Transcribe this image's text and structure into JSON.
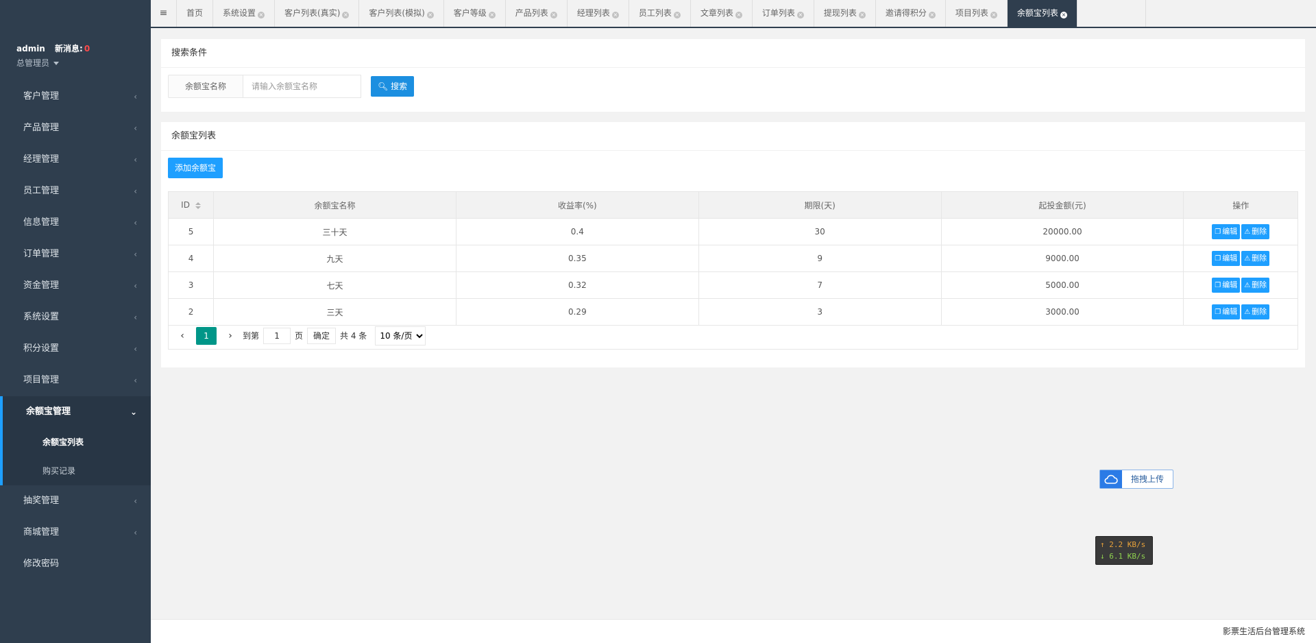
{
  "user": {
    "name": "admin",
    "msg_label": "新消息:",
    "msg_count": "0",
    "role": "总管理员"
  },
  "sidebar": {
    "items_top": [
      {
        "label": "客户管理"
      },
      {
        "label": "产品管理"
      },
      {
        "label": "经理管理"
      },
      {
        "label": "员工管理"
      },
      {
        "label": "信息管理"
      },
      {
        "label": "订单管理"
      },
      {
        "label": "资金管理"
      },
      {
        "label": "系统设置"
      },
      {
        "label": "积分设置"
      },
      {
        "label": "项目管理"
      }
    ],
    "active_group": {
      "label": "余额宝管理",
      "children": [
        {
          "label": "余额宝列表"
        },
        {
          "label": "购买记录"
        }
      ]
    },
    "items_bottom": [
      {
        "label": "抽奖管理"
      },
      {
        "label": "商城管理"
      },
      {
        "label": "修改密码"
      }
    ]
  },
  "tabs": [
    {
      "label": "首页"
    },
    {
      "label": "系统设置"
    },
    {
      "label": "客户列表(真实)"
    },
    {
      "label": "客户列表(模拟)"
    },
    {
      "label": "客户等级"
    },
    {
      "label": "产品列表"
    },
    {
      "label": "经理列表"
    },
    {
      "label": "员工列表"
    },
    {
      "label": "文章列表"
    },
    {
      "label": "订单列表"
    },
    {
      "label": "提现列表"
    },
    {
      "label": "邀请得积分"
    },
    {
      "label": "项目列表"
    },
    {
      "label": "余额宝列表"
    }
  ],
  "search": {
    "title": "搜索条件",
    "label": "余额宝名称",
    "placeholder": "请输入余额宝名称",
    "value": "",
    "button": "搜索"
  },
  "list": {
    "title": "余额宝列表",
    "add_button": "添加余额宝",
    "columns": [
      "ID",
      "余额宝名称",
      "收益率(%)",
      "期限(天)",
      "起投金额(元)",
      "操作"
    ],
    "rows": [
      {
        "id": "5",
        "name": "三十天",
        "rate": "0.4",
        "days": "30",
        "min": "20000.00"
      },
      {
        "id": "4",
        "name": "九天",
        "rate": "0.35",
        "days": "9",
        "min": "9000.00"
      },
      {
        "id": "3",
        "name": "七天",
        "rate": "0.32",
        "days": "7",
        "min": "5000.00"
      },
      {
        "id": "2",
        "name": "三天",
        "rate": "0.29",
        "days": "3",
        "min": "3000.00"
      }
    ],
    "edit_label": "编辑",
    "delete_label": "删除"
  },
  "pager": {
    "current": "1",
    "goto_label": "到第",
    "page_value": "1",
    "page_unit": "页",
    "confirm": "确定",
    "total": "共 4 条",
    "per_page": "10 条/页"
  },
  "upload": {
    "label": "拖拽上传"
  },
  "netspeed": {
    "up": "↑ 2.2 KB/s",
    "down": "↓ 6.1 KB/s"
  },
  "footer": {
    "text": "影票生活后台管理系统"
  }
}
